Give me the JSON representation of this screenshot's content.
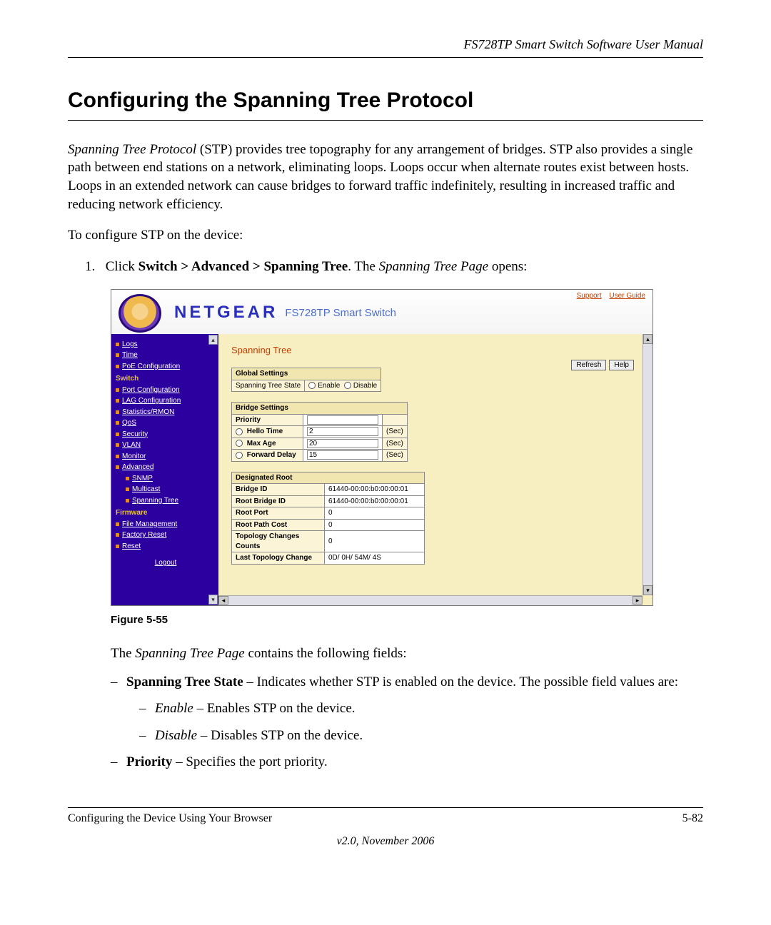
{
  "doc": {
    "running_header": "FS728TP Smart Switch Software User Manual",
    "section_title": "Configuring the Spanning Tree Protocol",
    "para1_a": "Spanning Tree Protocol",
    "para1_b": " (STP) provides tree topography for any arrangement of bridges. STP also provides a single path between end stations on a network, eliminating loops. Loops occur when alternate routes exist between hosts. Loops in an extended network can cause bridges to forward traffic indefinitely, resulting in increased traffic and reducing network efficiency.",
    "para2": "To configure STP on the device:",
    "step1_num": "1.",
    "step1_a": "Click ",
    "step1_b": "Switch > Advanced > Spanning Tree",
    "step1_c": ". The ",
    "step1_d": "Spanning Tree Page",
    "step1_e": " opens:",
    "figure_caption": "Figure 5-55",
    "fields_intro_a": "The ",
    "fields_intro_b": "Spanning Tree Page",
    "fields_intro_c": " contains the following fields:",
    "f1_dash": "–",
    "f1_label": "Spanning Tree State",
    "f1_text": " – Indicates whether STP is enabled on the device. The possible field values are:",
    "f1a_label": "Enable",
    "f1a_text": " – Enables STP on the device.",
    "f1b_label": "Disable",
    "f1b_text": " – Disables STP on the device.",
    "f2_label": "Priority",
    "f2_text": " – Specifies the port priority.",
    "footer_left": "Configuring the Device Using Your Browser",
    "footer_right": "5-82",
    "footer_version": "v2.0, November 2006"
  },
  "app": {
    "brand": "NETGEAR",
    "brand_sub": "FS728TP Smart Switch",
    "links": {
      "support": "Support",
      "guide": "User Guide"
    },
    "nav": {
      "top": [
        "Logs",
        "Time",
        "PoE Configuration"
      ],
      "switch_cat": "Switch",
      "switch_items": [
        "Port Configuration",
        "LAG Configuration",
        "Statistics/RMON",
        "QoS",
        "Security",
        "VLAN",
        "Monitor",
        "Advanced"
      ],
      "adv_items": [
        "SNMP",
        "Multicast",
        "Spanning Tree"
      ],
      "firmware_cat": "Firmware",
      "firmware_items": [
        "File Management",
        "Factory Reset",
        "Reset"
      ],
      "logout": "Logout"
    },
    "content": {
      "title": "Spanning Tree",
      "refresh": "Refresh",
      "help": "Help",
      "global_hdr": "Global Settings",
      "stp_state_label": "Spanning Tree State",
      "enable": "Enable",
      "disable": "Disable",
      "bridge_hdr": "Bridge Settings",
      "priority": "Priority",
      "hello_time": "Hello Time",
      "hello_time_val": "2",
      "max_age": "Max Age",
      "max_age_val": "20",
      "fwd_delay": "Forward Delay",
      "fwd_delay_val": "15",
      "sec": "(Sec)",
      "root_hdr": "Designated Root",
      "bridge_id": "Bridge ID",
      "bridge_id_val": "61440-00:00:b0:00:00:01",
      "root_bridge_id": "Root Bridge ID",
      "root_bridge_id_val": "61440-00:00:b0:00:00:01",
      "root_port": "Root Port",
      "root_port_val": "0",
      "root_path": "Root Path Cost",
      "root_path_val": "0",
      "topo_changes": "Topology Changes Counts",
      "topo_changes_val": "0",
      "last_topo": "Last Topology Change",
      "last_topo_val": "0D/ 0H/ 54M/ 4S"
    }
  }
}
